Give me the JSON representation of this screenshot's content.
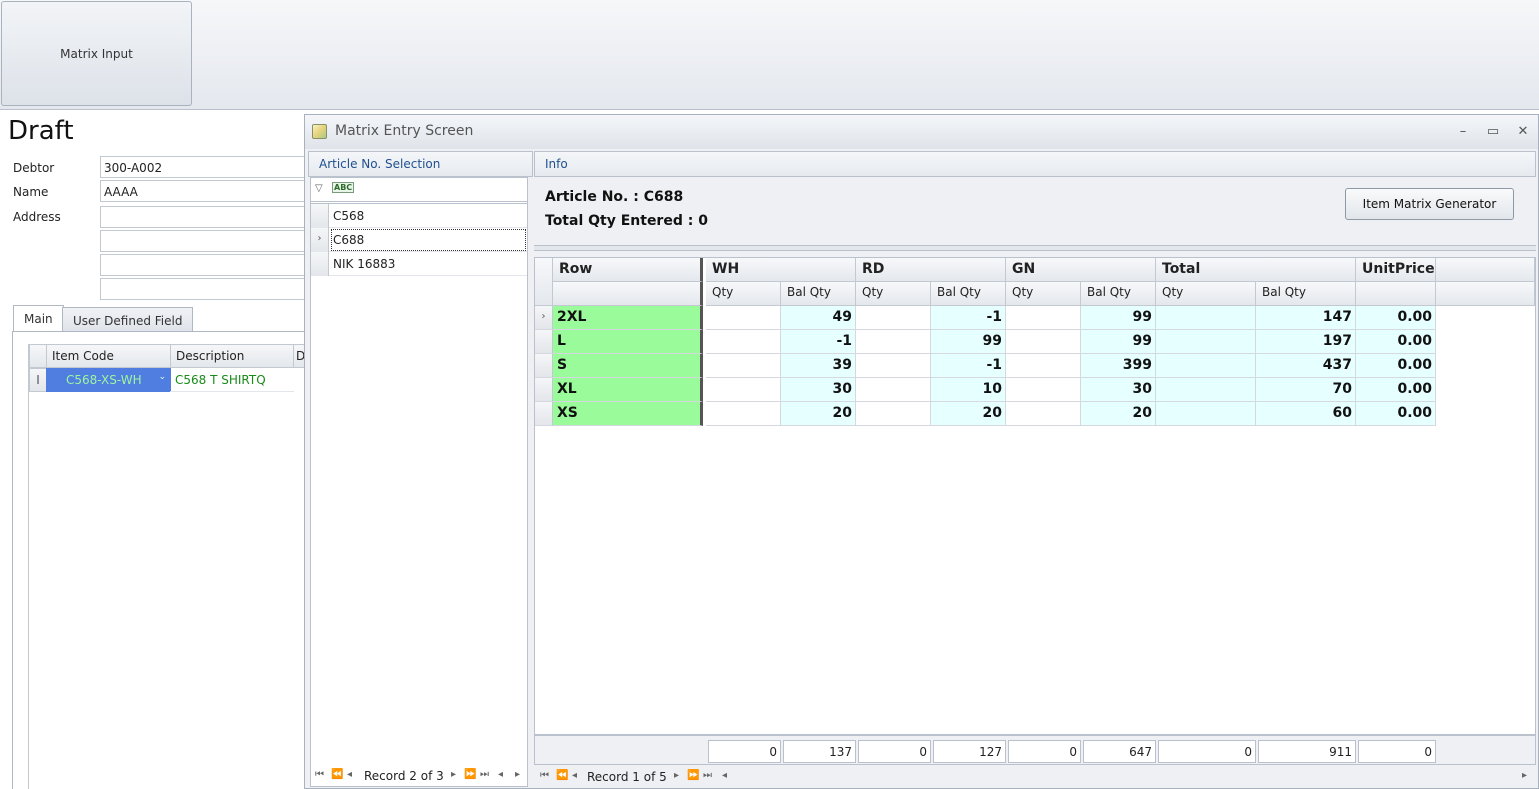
{
  "ribbon": {
    "matrix_input_label": "Matrix Input"
  },
  "form": {
    "title": "Draft",
    "debtor_label": "Debtor",
    "debtor_value": "300-A002",
    "name_label": "Name",
    "name_value": "AAAA",
    "address_label": "Address",
    "tabs": [
      "Main",
      "User Defined Field"
    ],
    "grid_headers": {
      "item_code": "Item Code",
      "description": "Description",
      "extra": "D"
    },
    "grid_row": {
      "indicator": "I",
      "item_code": "C568-XS-WH",
      "description": "C568 T SHIRTQ"
    }
  },
  "window": {
    "title": "Matrix Entry Screen",
    "icon": "matrix-window-icon",
    "controls": {
      "minimize": "–",
      "maximize": "▭",
      "close": "✕"
    }
  },
  "article_panel": {
    "header": "Article No. Selection",
    "items": [
      "C568",
      "C688",
      "NIK 16883"
    ],
    "selected_index": 1,
    "record_text": "Record 2 of 3"
  },
  "info_panel": {
    "header": "Info",
    "article_line": "Article No. :  C688",
    "total_line": "Total Qty Entered : 0",
    "generator_button": "Item Matrix Generator"
  },
  "matrix": {
    "row_header": "Row",
    "groups": [
      "WH",
      "RD",
      "GN",
      "Total"
    ],
    "unit_price_header": "UnitPrice",
    "sub_qty": "Qty",
    "sub_bal": "Bal Qty",
    "rows": [
      {
        "name": "2XL",
        "wh_bal": "49",
        "rd_bal": "-1",
        "gn_bal": "99",
        "total_bal": "147",
        "price": "0.00"
      },
      {
        "name": "L",
        "wh_bal": "-1",
        "rd_bal": "99",
        "gn_bal": "99",
        "total_bal": "197",
        "price": "0.00"
      },
      {
        "name": "S",
        "wh_bal": "39",
        "rd_bal": "-1",
        "gn_bal": "399",
        "total_bal": "437",
        "price": "0.00"
      },
      {
        "name": "XL",
        "wh_bal": "30",
        "rd_bal": "10",
        "gn_bal": "30",
        "total_bal": "70",
        "price": "0.00"
      },
      {
        "name": "XS",
        "wh_bal": "20",
        "rd_bal": "20",
        "gn_bal": "20",
        "total_bal": "60",
        "price": "0.00"
      }
    ],
    "footer": [
      "0",
      "137",
      "0",
      "127",
      "0",
      "647",
      "0",
      "911",
      "0"
    ],
    "record_text": "Record 1 of 5"
  },
  "colors": {
    "row_name_bg": "#99fb99",
    "bal_bg": "#e6ffff",
    "link_blue": "#1f4f8f",
    "item_code_bg": "#4f7de0",
    "desc_green": "#1a8a1a"
  }
}
